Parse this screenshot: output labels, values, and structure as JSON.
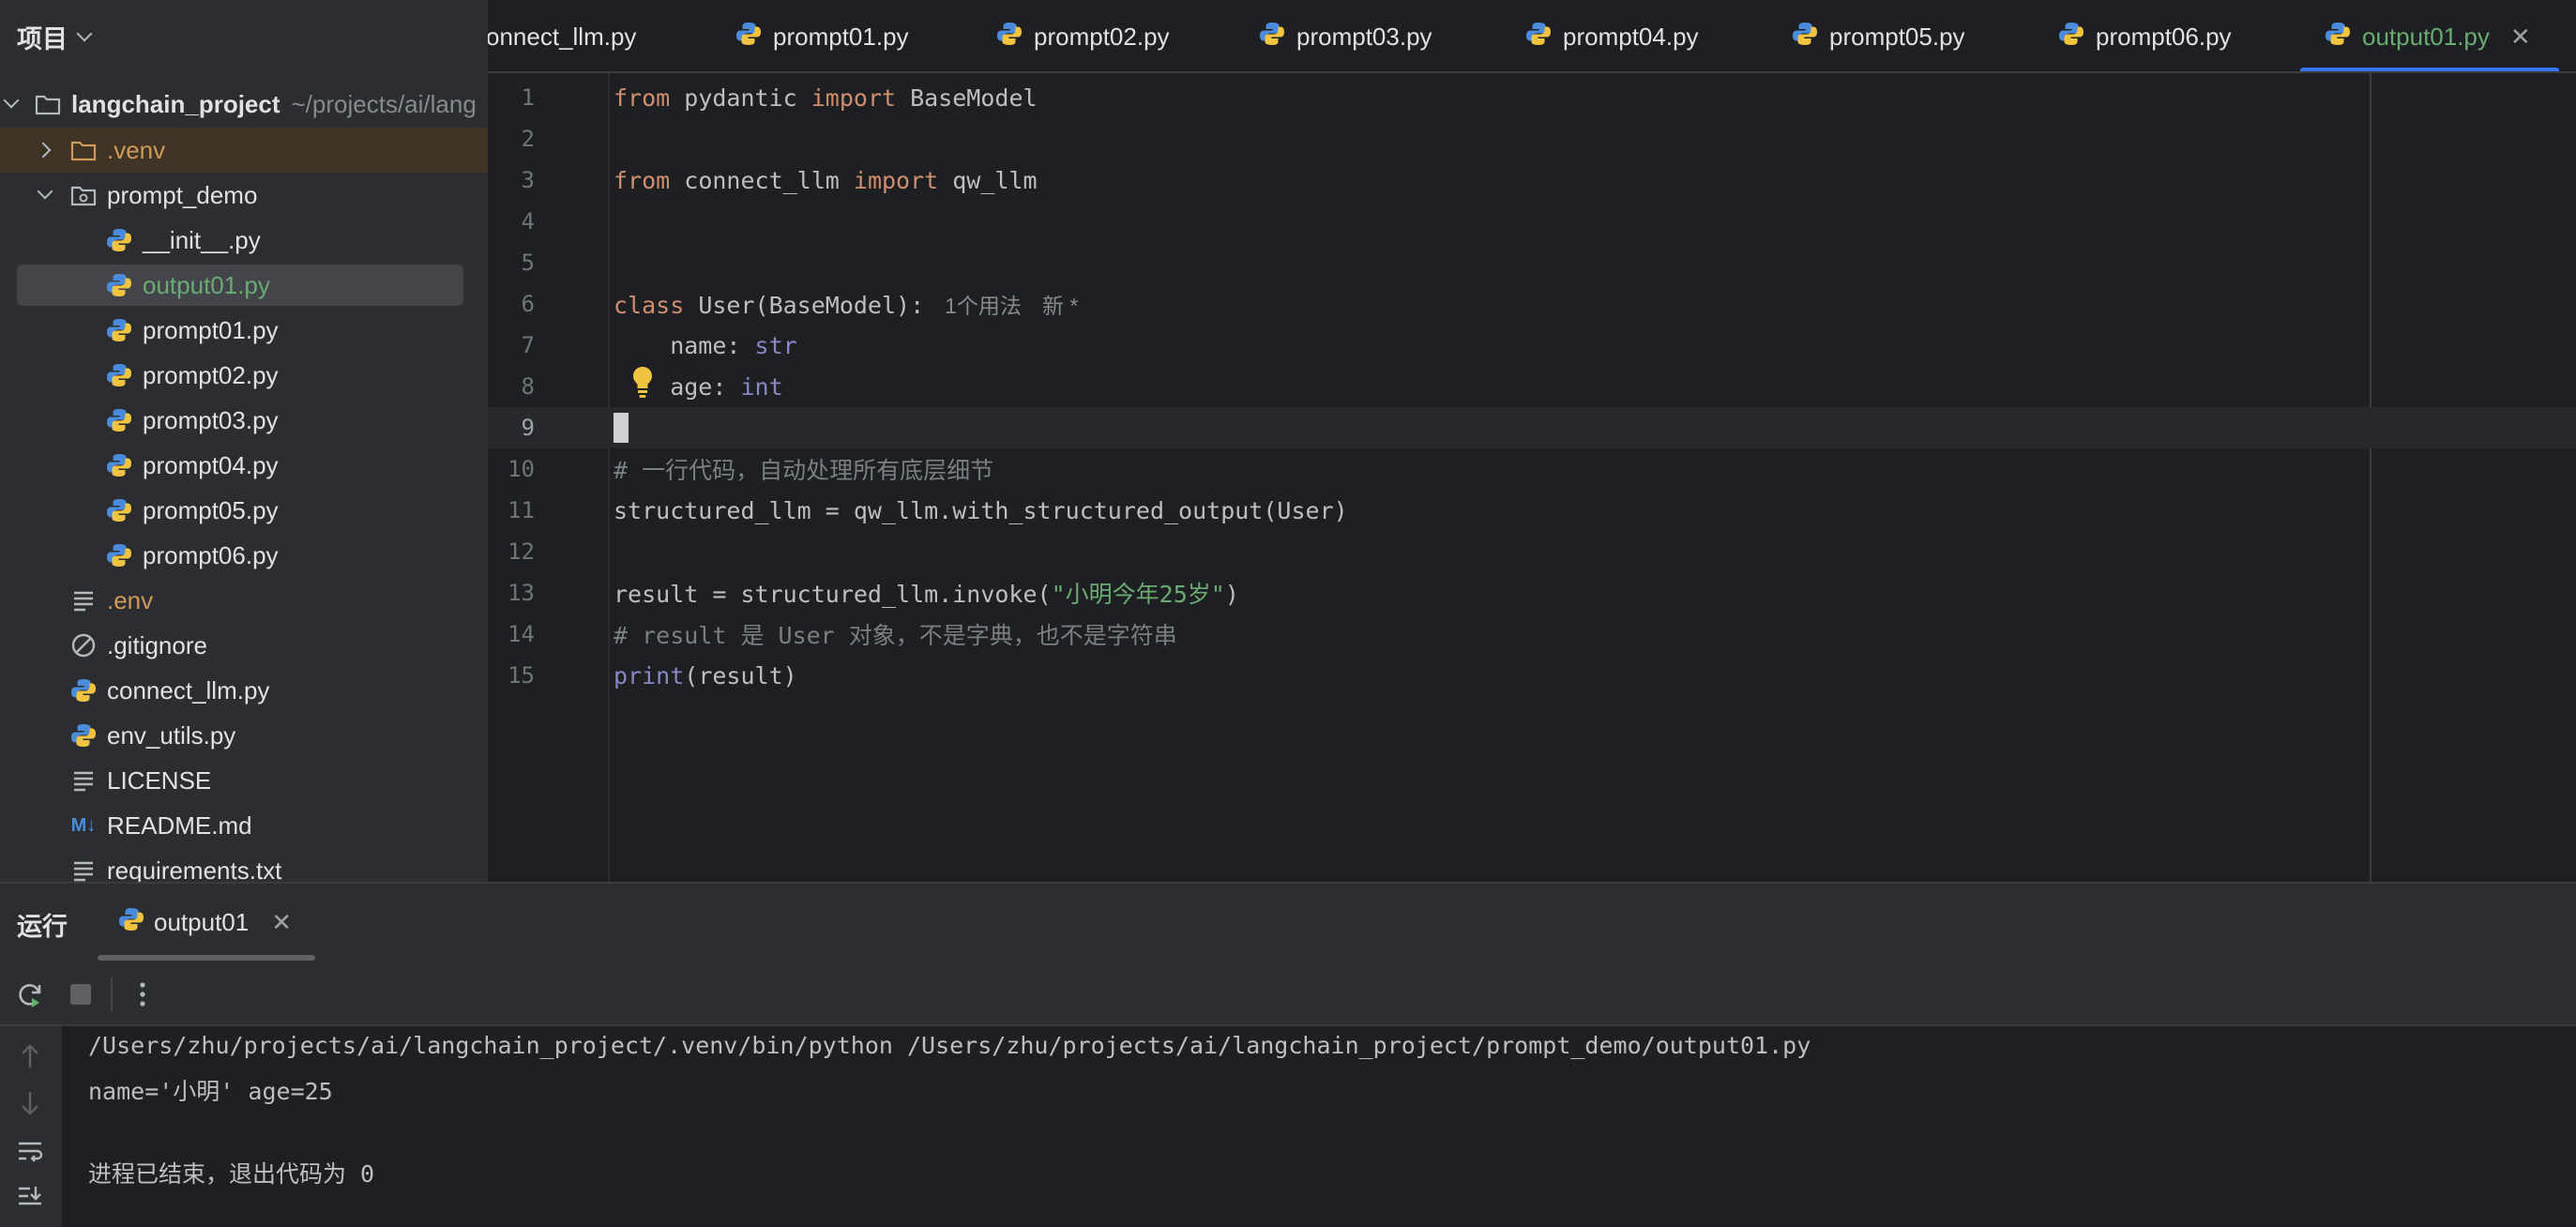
{
  "sidebar": {
    "title": "项目",
    "project": {
      "name": "langchain_project",
      "path": "~/projects/ai/lang"
    },
    "items": [
      {
        "label": ".venv",
        "type": "folder",
        "expanded": false
      },
      {
        "label": "prompt_demo",
        "type": "package",
        "expanded": true
      },
      {
        "label": "__init__.py",
        "type": "python"
      },
      {
        "label": "output01.py",
        "type": "python",
        "selected": true
      },
      {
        "label": "prompt01.py",
        "type": "python"
      },
      {
        "label": "prompt02.py",
        "type": "python"
      },
      {
        "label": "prompt03.py",
        "type": "python"
      },
      {
        "label": "prompt04.py",
        "type": "python"
      },
      {
        "label": "prompt05.py",
        "type": "python"
      },
      {
        "label": "prompt06.py",
        "type": "python"
      },
      {
        "label": ".env",
        "type": "text"
      },
      {
        "label": ".gitignore",
        "type": "ignore"
      },
      {
        "label": "connect_llm.py",
        "type": "python"
      },
      {
        "label": "env_utils.py",
        "type": "python"
      },
      {
        "label": "LICENSE",
        "type": "text"
      },
      {
        "label": "README.md",
        "type": "markdown",
        "icon_text": "M↓"
      },
      {
        "label": "requirements.txt",
        "type": "text"
      }
    ]
  },
  "tabs": [
    {
      "label": "onnect_llm.py"
    },
    {
      "label": "prompt01.py"
    },
    {
      "label": "prompt02.py"
    },
    {
      "label": "prompt03.py"
    },
    {
      "label": "prompt04.py"
    },
    {
      "label": "prompt05.py"
    },
    {
      "label": "prompt06.py"
    },
    {
      "label": "output01.py",
      "active": true,
      "close": "✕"
    }
  ],
  "editor": {
    "line_numbers": [
      "1",
      "2",
      "3",
      "4",
      "5",
      "6",
      "7",
      "8",
      "9",
      "10",
      "11",
      "12",
      "13",
      "14",
      "15"
    ],
    "current_line": 9,
    "code": {
      "l1": {
        "kw1": "from",
        "mod": " pydantic ",
        "kw2": "import",
        "name": " BaseModel"
      },
      "l3": {
        "kw1": "from",
        "mod": " connect_llm ",
        "kw2": "import",
        "name": " qw_llm"
      },
      "l6": {
        "kw": "class",
        "rest": " User(BaseModel):",
        "hint_usages": "1个用法",
        "hint_new": "新 *"
      },
      "l7": {
        "indent": "    name: ",
        "type": "str"
      },
      "l8": {
        "indent": "    age: ",
        "type": "int"
      },
      "l10": "# 一行代码，自动处理所有底层细节",
      "l11": "structured_llm = qw_llm.with_structured_output(User)",
      "l13": {
        "pre": "result = structured_llm.invoke(",
        "str": "\"小明今年25岁\"",
        "post": ")"
      },
      "l14": "# result 是 User 对象，不是字典，也不是字符串",
      "l15": {
        "fn": "print",
        "rest": "(result)"
      }
    }
  },
  "run_panel": {
    "title": "运行",
    "tab_label": "output01",
    "tab_close": "✕",
    "console": [
      "/Users/zhu/projects/ai/langchain_project/.venv/bin/python /Users/zhu/projects/ai/langchain_project/prompt_demo/output01.py",
      "name='小明' age=25",
      "",
      "进程已结束，退出代码为 0"
    ]
  },
  "colors": {
    "accent": "#3574f0",
    "keyword": "#cf8e6d",
    "string": "#6aab73",
    "builtin": "#8888c6",
    "comment": "#7a7e85"
  }
}
